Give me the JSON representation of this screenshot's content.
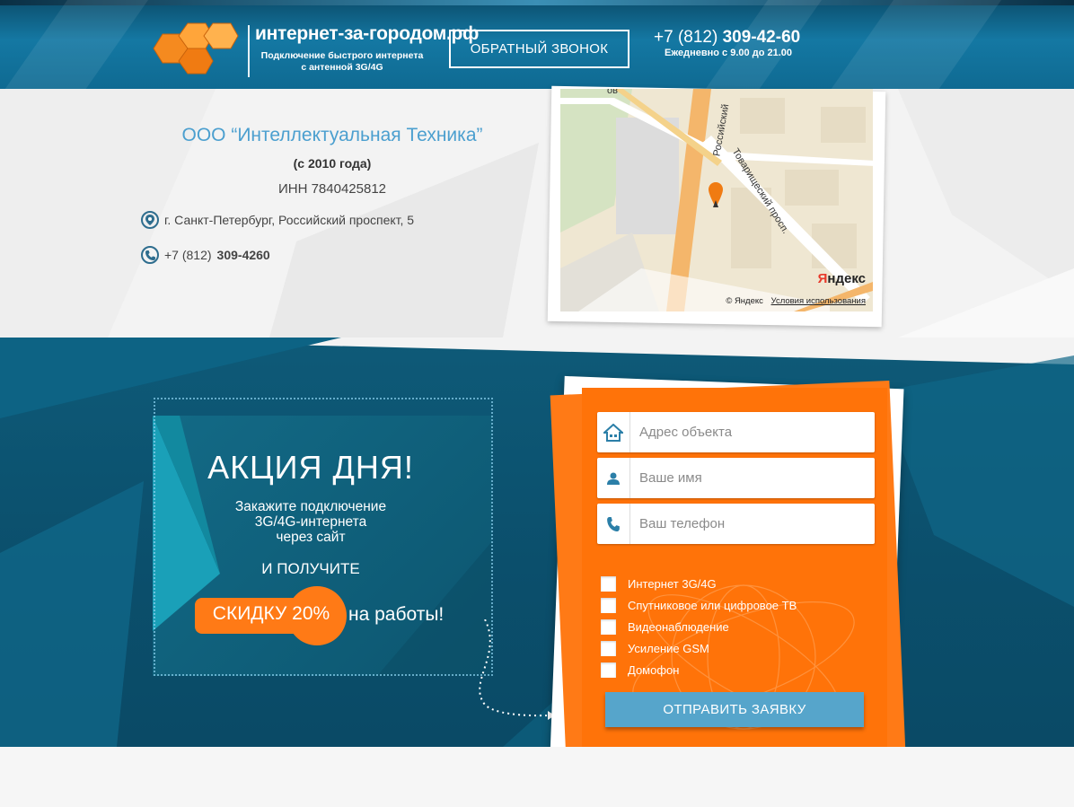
{
  "header": {
    "site_name": "интернет-за-городом.рф",
    "tagline_line1": "Подключение быстрого интернета",
    "tagline_line2": "с антенной 3G/4G",
    "callback_label": "ОБРАТНЫЙ ЗВОНОК",
    "phone_prefix": "+7 (812)",
    "phone_main": "309-42-60",
    "hours_prefix": "Ежедневно",
    "hours_from_word": "с",
    "hours_from": "9.00",
    "hours_to_word": "до",
    "hours_to": "21.00"
  },
  "contact": {
    "company": "ООО “Интеллектуальная Техника”",
    "since": "(с 2010 года)",
    "inn": "ИНН 7840425812",
    "address": "г. Санкт-Петербург, Российский проспект, 5",
    "phone_prefix": "+7 (812)",
    "phone_main": "309-4260",
    "map": {
      "street1": "Российский",
      "street2": "Товарищеский просп.",
      "street_top": "ов",
      "brand_first": "Я",
      "brand_rest": "ндекс",
      "credit": "© Яндекс",
      "terms": "Условия использования"
    }
  },
  "promo": {
    "title": "АКЦИЯ ДНЯ!",
    "line1": "Закажите подключение",
    "line2": "3G/4G-интернета",
    "line3": "через сайт",
    "get": "И ПОЛУЧИТЕ",
    "discount": "СКИДКУ 20%",
    "discount_tail": "на работы!"
  },
  "form": {
    "address_placeholder": "Адрес объекта",
    "name_placeholder": "Ваше имя",
    "phone_placeholder": "Ваш телефон",
    "options": [
      "Интернет 3G/4G",
      "Спутниковое или цифровое ТВ",
      "Видеонаблюдение",
      "Усиление GSM",
      "Домофон"
    ],
    "submit_label": "ОТПРАВИТЬ ЗАЯВКУ"
  },
  "colors": {
    "accent_orange": "#ff7309",
    "header_blue": "#1478a3",
    "promo_blue": "#0e5a78",
    "link_blue": "#4b9fcf",
    "submit_blue": "#56a5cb"
  }
}
